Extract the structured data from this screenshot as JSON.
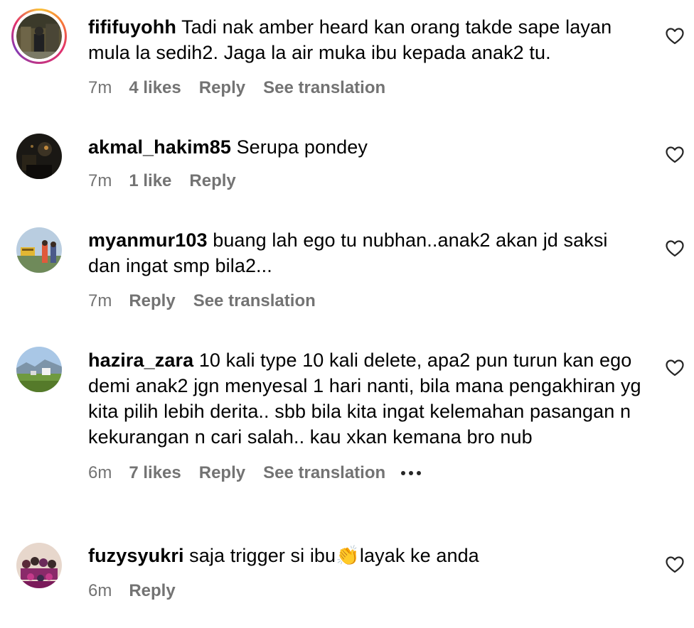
{
  "comments": [
    {
      "username": "fififuyohh",
      "text": "Tadi nak amber heard kan orang takde sape layan mula la sedih2. Jaga la air muka ibu kepada anak2 tu.",
      "time": "7m",
      "likes": "4 likes",
      "reply_label": "Reply",
      "translation_label": "See translation",
      "has_story_ring": true
    },
    {
      "username": "akmal_hakim85",
      "text": "Serupa pondey",
      "time": "7m",
      "likes": "1 like",
      "reply_label": "Reply"
    },
    {
      "username": "myanmur103",
      "text": "buang lah ego tu nubhan..anak2 akan jd saksi dan ingat smp bila2...",
      "time": "7m",
      "reply_label": "Reply",
      "translation_label": "See translation"
    },
    {
      "username": "hazira_zara",
      "text": "10 kali type 10 kali delete, apa2 pun turun kan ego demi anak2 jgn menyesal 1 hari nanti, bila mana pengakhiran yg kita pilih lebih derita.. sbb bila kita ingat kelemahan pasangan n kekurangan n cari salah.. kau xkan kemana bro nub",
      "time": "6m",
      "likes": "7 likes",
      "reply_label": "Reply",
      "translation_label": "See translation",
      "more_icon": "ellipsis-icon"
    },
    {
      "username": "fuzysyukri",
      "text": "saja trigger si ibu👏layak ke anda",
      "time": "6m",
      "reply_label": "Reply"
    }
  ],
  "icons": {
    "like": "heart-outline-icon"
  },
  "colors": {
    "meta_text": "#737373",
    "story_ring": [
      "#f9c338",
      "#e1306c",
      "#833ab4"
    ]
  }
}
